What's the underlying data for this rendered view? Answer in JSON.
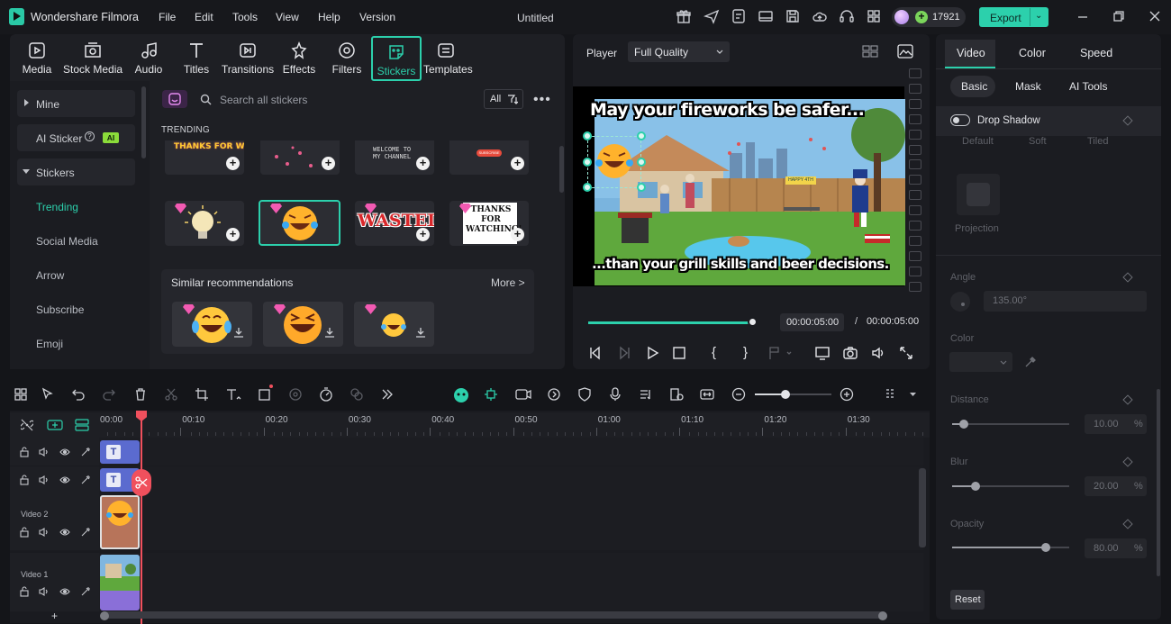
{
  "app": {
    "name": "Wondershare Filmora",
    "title": "Untitled",
    "credits": "17921",
    "export_label": "Export",
    "export_arrow": "⌄"
  },
  "menu": [
    "File",
    "Edit",
    "Tools",
    "View",
    "Help",
    "Version"
  ],
  "tools": [
    "Media",
    "Stock Media",
    "Audio",
    "Titles",
    "Transitions",
    "Effects",
    "Filters",
    "Stickers",
    "Templates"
  ],
  "sidebar": {
    "mine": "Mine",
    "ai_sticker": "AI Sticker",
    "ai_badge": "AI",
    "stickers": "Stickers",
    "subs": [
      "Trending",
      "Social Media",
      "Arrow",
      "Subscribe",
      "Emoji"
    ]
  },
  "content": {
    "search_placeholder": "Search all stickers",
    "filter_label": "All",
    "section": "TRENDING",
    "row1_texts": [
      "THANKS FOR WATCHING",
      "",
      "WELCOME TO MY CHANNEL",
      "SUBSCRIBE"
    ],
    "row2_texts": [
      "",
      "",
      "WASTED",
      "THANKS FOR WATCHING!"
    ],
    "similar_title": "Similar recommendations",
    "more_label": "More >"
  },
  "player": {
    "label": "Player",
    "quality": "Full Quality",
    "caption_top": "May your fireworks be safer...",
    "caption_bottom": "...than your grill skills and beer decisions.",
    "banner": "HAPPY 4TH",
    "current": "00:00:05:00",
    "sep": "/",
    "total": "00:00:05:00",
    "progress": 1.0
  },
  "props": {
    "tabs": [
      "Video",
      "Color",
      "Speed"
    ],
    "subtabs": [
      "Basic",
      "Mask",
      "AI Tools"
    ],
    "drop_shadow": "Drop Shadow",
    "presets": [
      "Default",
      "Soft",
      "Tiled"
    ],
    "projection": "Projection",
    "angle_label": "Angle",
    "angle_value": "135.00°",
    "color_label": "Color",
    "distance_label": "Distance",
    "distance_value": "10.00",
    "blur_label": "Blur",
    "blur_value": "20.00",
    "opacity_label": "Opacity",
    "opacity_value": "80.00",
    "unit": "%",
    "reset": "Reset",
    "distance_level": 0.1,
    "blur_level": 0.2,
    "opacity_level": 0.8
  },
  "timeline": {
    "ticks": [
      "00:00",
      "00:10",
      "00:20",
      "00:30",
      "00:40",
      "00:50",
      "01:00",
      "01:10",
      "01:20",
      "01:30"
    ],
    "tracks": [
      "Video 2",
      "Video 1"
    ],
    "text_clip": "T",
    "add": "+"
  },
  "colors": {
    "accent": "#2cd0ac",
    "playhead": "#f0505d",
    "text_clip": "#5b6bcf"
  }
}
